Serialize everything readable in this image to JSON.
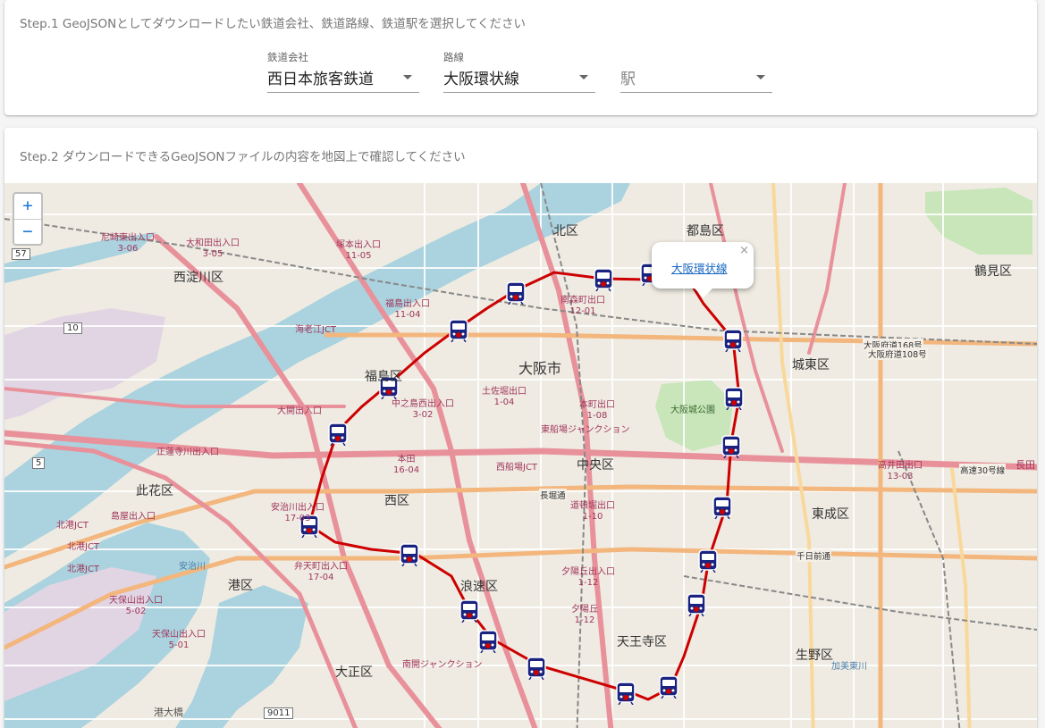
{
  "step1": {
    "title": "Step.1 GeoJSONとしてダウンロードしたい鉄道会社、鉄道路線、鉄道駅を選択してください",
    "company": {
      "label": "鉄道会社",
      "value": "西日本旅客鉄道"
    },
    "line": {
      "label": "路線",
      "value": "大阪環状線"
    },
    "station": {
      "placeholder": "駅"
    }
  },
  "step2": {
    "title": "Step.2 ダウンロードできるGeoJSONファイルの内容を地図上で確認してください"
  },
  "map": {
    "zoom_in": "+",
    "zoom_out": "−",
    "popup": {
      "link": "大阪環状線",
      "close": "×"
    },
    "colors": {
      "route": "#cc0000",
      "station_icon": "#1a2380",
      "water": "#aad3df",
      "road_major": "#e8919b",
      "road_trunk": "#f3b67d"
    },
    "districts": [
      "北区",
      "都島区",
      "鶴見区",
      "西淀川区",
      "城東区",
      "福島区",
      "中央区",
      "此花区",
      "西区",
      "東成区",
      "港区",
      "浪速区",
      "天王寺区",
      "生野区",
      "大正区",
      "大阪市"
    ],
    "interchanges": [
      {
        "name": "尼崎東出入口",
        "code": "3-06"
      },
      {
        "name": "大和田出入口",
        "code": "3-05"
      },
      {
        "name": "塚本出入口",
        "code": "11-05"
      },
      {
        "name": "福島出入口",
        "code": "11-04"
      },
      {
        "name": "南森町出口",
        "code": "12-01"
      },
      {
        "name": "中之島西出入口",
        "code": "3-02"
      },
      {
        "name": "大開出入口",
        "code": ""
      },
      {
        "name": "土佐堀出口",
        "code": "1-04"
      },
      {
        "name": "本町出口",
        "code": "1-08"
      },
      {
        "name": "東船場ジャンクション",
        "code": ""
      },
      {
        "name": "本田",
        "code": "16-04"
      },
      {
        "name": "西船場JCT",
        "code": ""
      },
      {
        "name": "道頓堀出口",
        "code": "1-10"
      },
      {
        "name": "安治川出入口",
        "code": "17-03"
      },
      {
        "name": "弁天町出入口",
        "code": "17-04"
      },
      {
        "name": "夕陽丘出入口",
        "code": "1-12"
      },
      {
        "name": "夕陽丘",
        "code": "1-12"
      },
      {
        "name": "高井田出口",
        "code": "13-03"
      },
      {
        "name": "天保山出入口",
        "code": "5-02"
      },
      {
        "name": "天保山出入口",
        "code": "5-01"
      },
      {
        "name": "南開ジャンクション",
        "code": ""
      },
      {
        "name": "北港JCT",
        "code": ""
      },
      {
        "name": "北港JCT",
        "code": ""
      },
      {
        "name": "北港JCT",
        "code": ""
      },
      {
        "name": "海老江JCT",
        "code": ""
      },
      {
        "name": "正蓮寺川出入口",
        "code": ""
      },
      {
        "name": "島屋出入口",
        "code": ""
      }
    ],
    "misc_labels": [
      "大阪城公園",
      "長田",
      "港大橋",
      "安治川",
      "加美東川"
    ],
    "road_labels": [
      "高速30号線",
      "大阪府道168号",
      "大阪府道108号",
      "長堀通",
      "千日前通"
    ],
    "shields": [
      "57",
      "10",
      "5",
      "9011"
    ]
  }
}
